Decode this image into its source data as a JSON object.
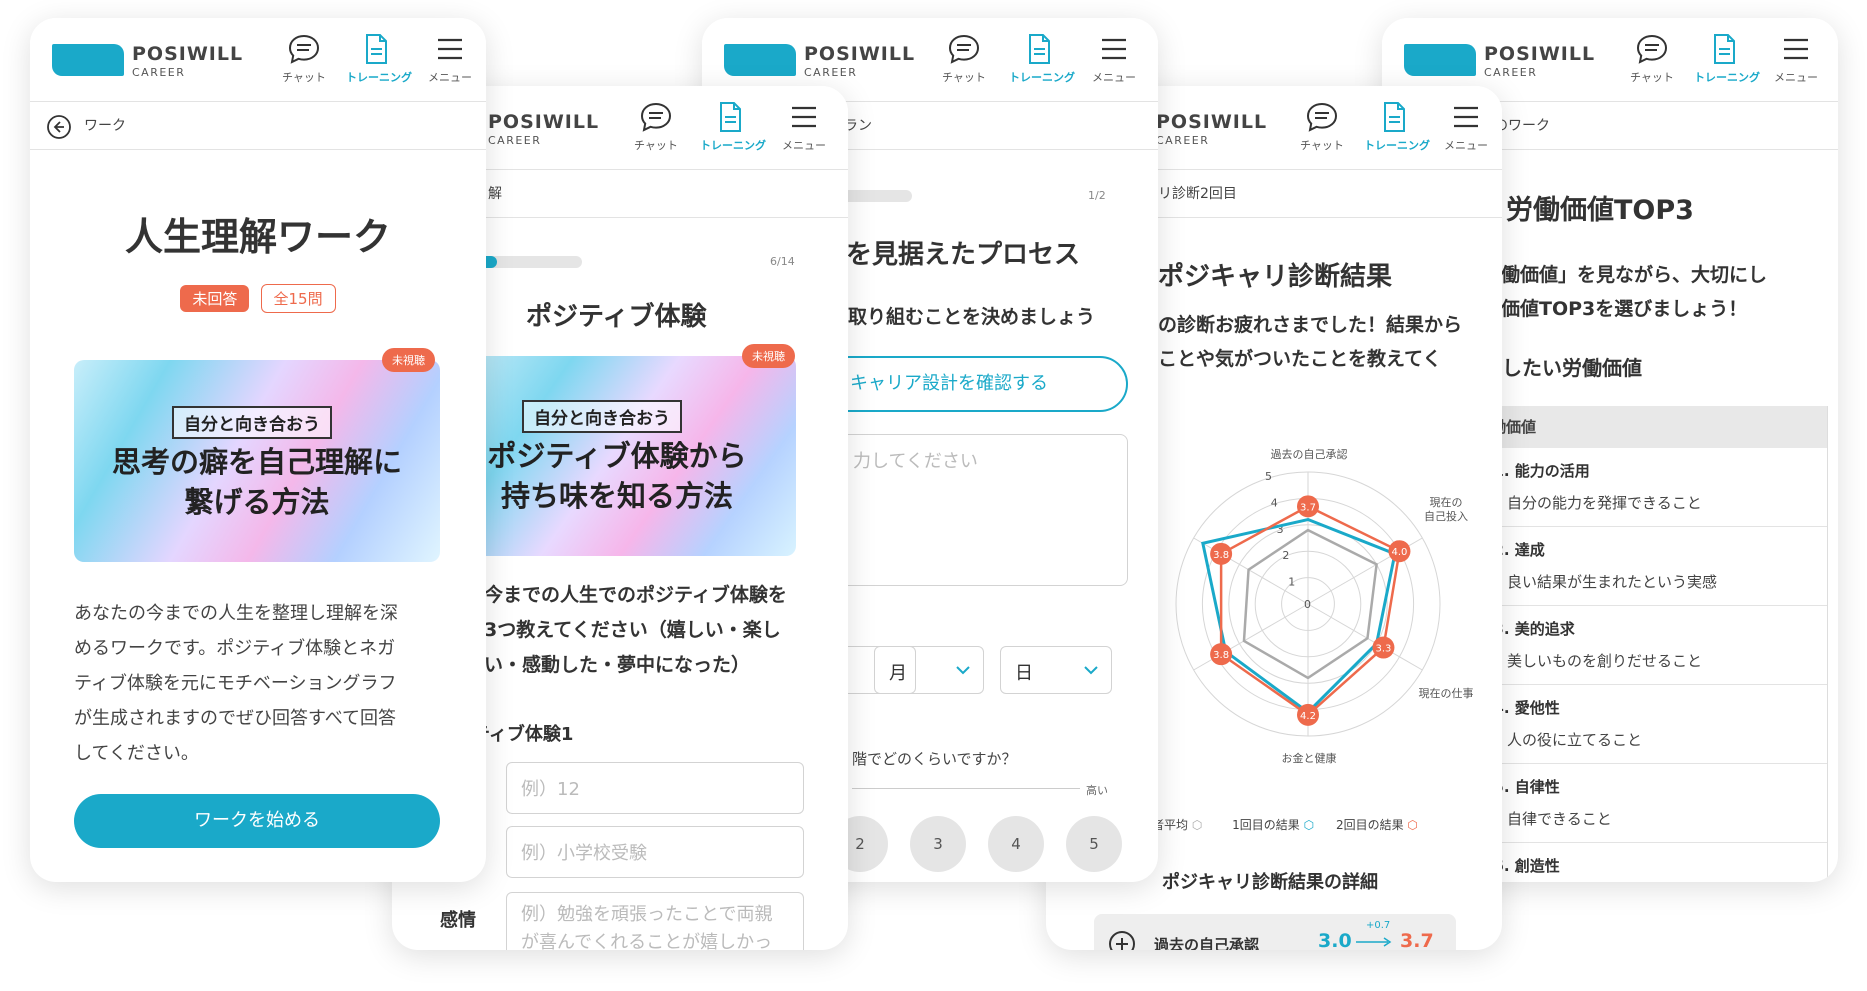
{
  "brand": {
    "name": "POSIWILL",
    "sub": "CAREER"
  },
  "nav": {
    "chat": "チャット",
    "training": "トレーニング",
    "menu": "メニュー"
  },
  "screen1": {
    "back": "ワーク",
    "title": "人生理解ワーク",
    "tag_unanswered": "未回答",
    "tag_total": "全15問",
    "badge": "未視聴",
    "thumb_label": "自分と向き合おう",
    "thumb_title": [
      "思考の癖を自己理解に",
      "繋げる方法"
    ],
    "desc": [
      "あなたの今までの人生を整理し理解を深",
      "めるワークです。ポジティブ体験とネガ",
      "ティブ体験を元にモチベーショングラフ",
      "が生成されますのでぜひ回答すべて回答",
      "してください。"
    ],
    "start": "ワークを始める"
  },
  "screen2": {
    "crumb": "解",
    "progress": "6/14",
    "progress_value": 0.55,
    "title": "ポジティブ体験",
    "badge": "未視聴",
    "thumb_label": "自分と向き合おう",
    "thumb_title": [
      "ポジティブ体験から",
      "持ち味を知る方法"
    ],
    "question": [
      "今までの人生でのポジティブ体験を",
      "3つ教えてください（嬉しい・楽し",
      "い・感動した・夢中になった）"
    ],
    "section": "ティブ体験1",
    "ph_age": "例）12",
    "ph_event": "例）小学校受験",
    "emotion_label": "感情",
    "ph_emotion": [
      "例）勉強を頑張ったことで両親",
      "が喜んでくれることが嬉しかっ"
    ]
  },
  "screen3": {
    "crumb": "ラン",
    "progress": "1/2",
    "progress_value": 0.5,
    "title": "を見据えたプロセス",
    "subtitle": "取り組むことを決めましょう",
    "btn": "キャリア設計を確認する",
    "ph_text": "力してください",
    "month": "月",
    "day": "日",
    "question": "階でどのくらいですか？",
    "high": "高い",
    "scale": [
      "2",
      "3",
      "4",
      "5"
    ]
  },
  "screen4": {
    "crumb": "リ診断2回目",
    "title": "ポジキャリ診断結果",
    "text": [
      "の診断お疲れさまでした！結果から",
      "ことや気がついたことを教えてく"
    ],
    "axes": {
      "top": "過去の自己承認",
      "right_top": [
        "現在の",
        "自己投入"
      ],
      "right_bottom": "現在の仕事",
      "bottom": "お金と健康"
    },
    "ticks": [
      "1",
      "2",
      "3",
      "4",
      "5"
    ],
    "tick0": "0",
    "values_second": [
      "3.7",
      "4.0",
      "3.3",
      "4.2",
      "3.8",
      "3.8"
    ],
    "legend": [
      "者平均",
      "1回目の結果",
      "2回目の結果"
    ],
    "detail_title": "ポジキャリ診断結果の詳細",
    "detail_item": "過去の自己承認",
    "detail_from": "3.0",
    "detail_delta": "+0.7",
    "detail_to": "3.7",
    "colors": {
      "avg": "#aaaaaa",
      "first": "#1aa9c9",
      "second": "#ee6a4c"
    }
  },
  "screen5": {
    "crumb": "値のワーク",
    "title": "労働価値TOP3",
    "text": [
      "労働価値」を見ながら、大切にし",
      "働価値TOP3を選びましょう！"
    ],
    "subtitle": "にしたい労働価値",
    "table_header": "働価値",
    "items": [
      {
        "title": "01. 能力の活用",
        "desc": "自分の能力を発揮できること"
      },
      {
        "title": "02. 達成",
        "desc": "良い結果が生まれたという実感"
      },
      {
        "title": "03. 美的追求",
        "desc": "美しいものを創りだせること"
      },
      {
        "title": "04. 愛他性",
        "desc": "人の役に立てること"
      },
      {
        "title": "05. 自律性",
        "desc": "自律できること"
      },
      {
        "title": "06. 創造性",
        "desc": ""
      }
    ]
  },
  "colors": {
    "accent": "#1aa9c9",
    "orange": "#ee6a4c"
  }
}
